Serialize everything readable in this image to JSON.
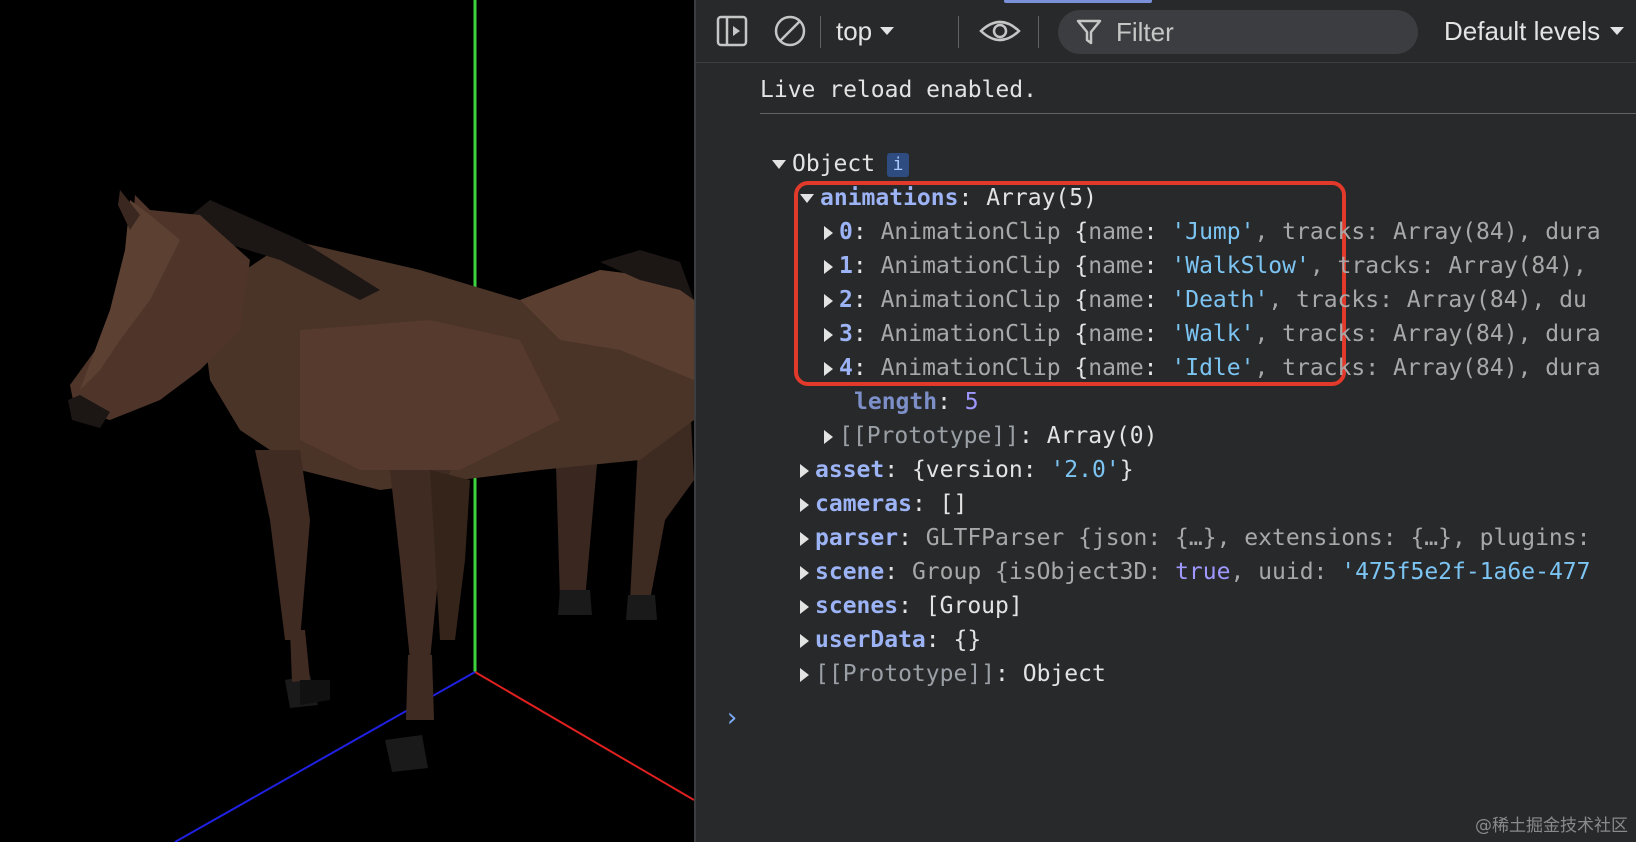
{
  "devtools": {
    "toolbar": {
      "context_label": "top",
      "filter_placeholder": "Filter",
      "levels_label": "Default levels"
    },
    "console": {
      "live_reload": "Live reload enabled.",
      "object": {
        "label": "Object",
        "info_badge": "i",
        "animations": {
          "key": "animations",
          "value": "Array(5)",
          "items": [
            {
              "index": "0",
              "type": "AnimationClip",
              "name": "'Jump'",
              "tail": ", tracks: Array(84), dura"
            },
            {
              "index": "1",
              "type": "AnimationClip",
              "name": "'WalkSlow'",
              "tail": ", tracks: Array(84),"
            },
            {
              "index": "2",
              "type": "AnimationClip",
              "name": "'Death'",
              "tail": ", tracks: Array(84), du"
            },
            {
              "index": "3",
              "type": "AnimationClip",
              "name": "'Walk'",
              "tail": ", tracks: Array(84), dura"
            },
            {
              "index": "4",
              "type": "AnimationClip",
              "name": "'Idle'",
              "tail": ", tracks: Array(84), dura"
            }
          ],
          "length_key": "length",
          "length_value": "5",
          "prototype_key": "[[Prototype]]",
          "prototype_value": "Array(0)"
        },
        "asset": {
          "key": "asset",
          "open": "{version: ",
          "version": "'2.0'",
          "close": "}"
        },
        "cameras": {
          "key": "cameras",
          "value": "[]"
        },
        "parser": {
          "key": "parser",
          "value": "GLTFParser {json: {…}, extensions: {…}, plugins:"
        },
        "scene": {
          "key": "scene",
          "value_pre": "Group {isObject3D: ",
          "bool": "true",
          "mid": ", uuid: ",
          "uuid": "'475f5e2f-1a6e-477"
        },
        "scenes": {
          "key": "scenes",
          "value": "[Group]"
        },
        "userData": {
          "key": "userData",
          "value": "{}"
        },
        "prototype": {
          "key": "[[Prototype]]",
          "value": "Object"
        }
      },
      "prompt": "›"
    }
  },
  "watermark": "@稀土掘金技术社区",
  "colors": {
    "highlight": "#e23a2a",
    "y_axis": "#3fd23f",
    "x_axis": "#e02020",
    "z_axis": "#2020e0",
    "horse": "#4a3327"
  }
}
